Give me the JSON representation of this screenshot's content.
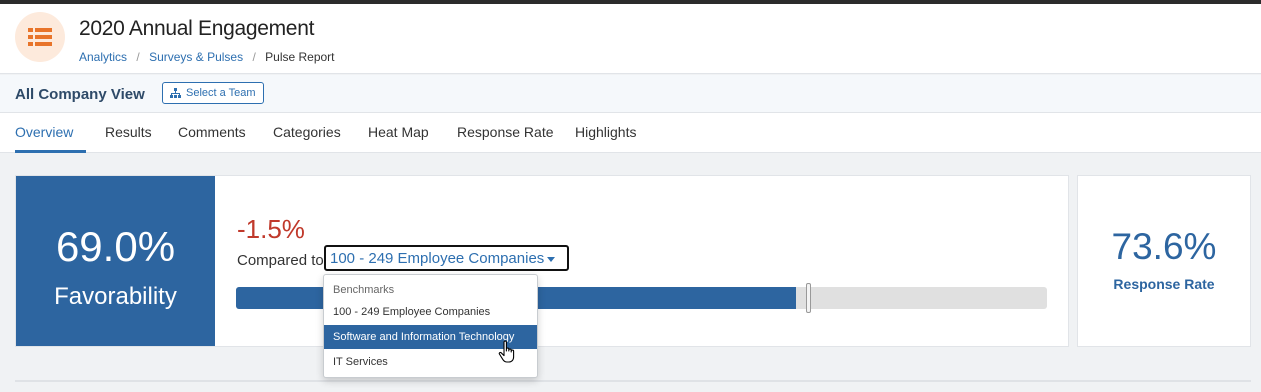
{
  "header": {
    "title": "2020 Annual Engagement",
    "app_icon": "list-icon",
    "accent_color": "#e8742a",
    "breadcrumb": {
      "analytics": "Analytics",
      "sep1": "/",
      "surveys": "Surveys & Pulses",
      "sep2": "/",
      "current": "Pulse Report"
    }
  },
  "viewbar": {
    "title": "All Company View",
    "select_team_label": "Select a Team",
    "select_team_icon": "org-chart-icon"
  },
  "tabs": [
    {
      "label": "Overview",
      "active": true
    },
    {
      "label": "Results"
    },
    {
      "label": "Comments"
    },
    {
      "label": "Categories"
    },
    {
      "label": "Heat Map"
    },
    {
      "label": "Response Rate"
    },
    {
      "label": "Highlights"
    }
  ],
  "favorability": {
    "value": "69.0%",
    "label": "Favorability",
    "bar_fraction": 0.69,
    "benchmark_fraction": 0.705,
    "brand_color": "#2d65a0"
  },
  "comparison": {
    "delta": "-1.5%",
    "delta_color": "#c0392b",
    "compared_label": "Compared to",
    "selected_benchmark": "100 - 249 Employee Companies"
  },
  "benchmark_dropdown": {
    "header": "Benchmarks",
    "options": [
      {
        "label": "100 - 249 Employee Companies"
      },
      {
        "label": "Software and Information Technology",
        "highlighted": true
      },
      {
        "label": "IT Services"
      }
    ]
  },
  "response_rate": {
    "value": "73.6%",
    "label": "Response Rate"
  }
}
